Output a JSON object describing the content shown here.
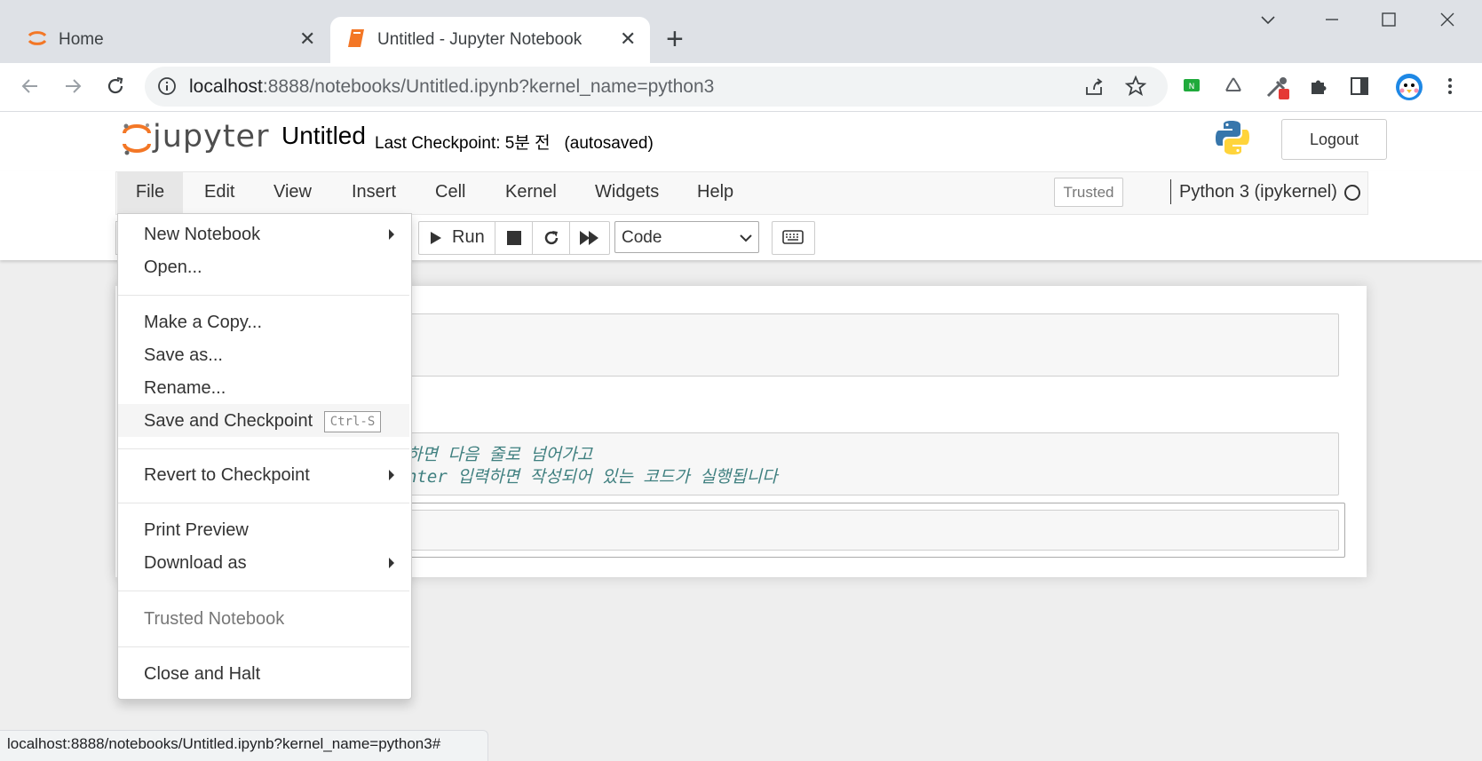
{
  "browser": {
    "tabs": [
      {
        "title": "Home"
      },
      {
        "title": "Untitled - Jupyter Notebook"
      }
    ],
    "url_host": "localhost",
    "url_rest": ":8888/notebooks/Untitled.ipynb?kernel_name=python3",
    "status_url": "localhost:8888/notebooks/Untitled.ipynb?kernel_name=python3#"
  },
  "jupyter": {
    "logo_text": "jupyter",
    "notebook_name": "Untitled",
    "checkpoint": "Last Checkpoint: 5분 전",
    "autosaved": "(autosaved)",
    "logout_label": "Logout",
    "menu": [
      "File",
      "Edit",
      "View",
      "Insert",
      "Cell",
      "Kernel",
      "Widgets",
      "Help"
    ],
    "trusted_label": "Trusted",
    "kernel_name": "Python 3 (ipykernel)",
    "run_label": "Run",
    "cell_type": "Code"
  },
  "cells": {
    "line1": "하면 다음 줄로 넘어가고",
    "line2": "nter 입력하면 작성되어 있는 코드가 실행됩니다"
  },
  "file_menu": {
    "new_notebook": "New Notebook",
    "open": "Open...",
    "make_copy": "Make a Copy...",
    "save_as": "Save as...",
    "rename": "Rename...",
    "save_checkpoint": "Save and Checkpoint",
    "save_shortcut": "Ctrl-S",
    "revert": "Revert to Checkpoint",
    "print_preview": "Print Preview",
    "download_as": "Download as",
    "trusted_notebook": "Trusted Notebook",
    "close_halt": "Close and Halt"
  },
  "colors": {
    "jupyter_orange": "#f37726",
    "code_comment": "#408080"
  }
}
